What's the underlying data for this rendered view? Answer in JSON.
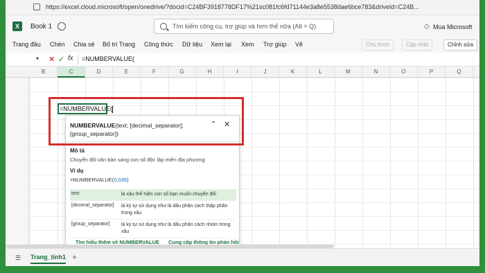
{
  "browser": {
    "url": "https://excel.cloud.microsoft/open/onedrive/?docid=C24BF3918778DF17%21sc081fc6fd71144e3a8e5538dae6bce783&driveId=C24B..."
  },
  "titlebar": {
    "app_letter": "X",
    "book_title": "Book 1",
    "search_placeholder": "Tìm kiếm công cụ, trợ giúp và hơn thế nữa (Alt + Q)",
    "buy_icon": "◇",
    "buy_label": "Mua Microsoft"
  },
  "menu": {
    "items": [
      "Trang đầu",
      "Chèn",
      "Chia sẻ",
      "Bố trí Trang",
      "Công thức",
      "Dữ liệu",
      "Xem lại",
      "Xem",
      "Trợ giúp",
      "Vẽ"
    ],
    "comment_btn": "Chú thích",
    "update_btn": "Cập nhật",
    "share_btn": "Chỉnh sửa"
  },
  "formula_bar": {
    "cancel_glyph": "✕",
    "enter_glyph": "✓",
    "fx_label": "fx",
    "formula": "=NUMBERVALUE("
  },
  "columns": [
    "B",
    "C",
    "D",
    "E",
    "F",
    "G",
    "H",
    "I",
    "J",
    "K",
    "L",
    "M",
    "N",
    "O",
    "P",
    "Q"
  ],
  "active_column": "C",
  "cell": {
    "text": "=NUMBERVALUE("
  },
  "tooltip": {
    "function_name": "NUMBERVALUE",
    "signature_args": "(text; [decimal_separator]; [group_separator])",
    "up_glyph": "⌃",
    "close_glyph": "✕",
    "desc_heading": "Mô tả",
    "description": "Chuyển đổi văn bản sang con số độc lập miền địa phương",
    "example_heading": "Ví dụ",
    "example_prefix": "=NUMBERVALUE(",
    "example_arg": "0,035",
    "example_suffix": ")",
    "args": [
      {
        "name": "text",
        "desc": "là xâu thể hiện con số bạn muốn chuyển đổi"
      },
      {
        "name": "[decimal_separator]",
        "desc": "là ký tự sử dụng như là dấu phân cách thập phân trong xâu"
      },
      {
        "name": "[group_separator]",
        "desc": "là ký tự sử dụng như là dấu phân cách nhóm trong xâu"
      }
    ],
    "learn_more": "Tìm hiểu thêm về NUMBERVALUE",
    "feedback": "Cung cấp thông tin phản hồi"
  },
  "sheets": {
    "menu_glyph": "☰",
    "tab": "Trang_tính1",
    "add_glyph": "+"
  },
  "colors": {
    "accent": "#1d6f42",
    "highlight": "#d32f2f",
    "frame": "#2f8f3a"
  }
}
